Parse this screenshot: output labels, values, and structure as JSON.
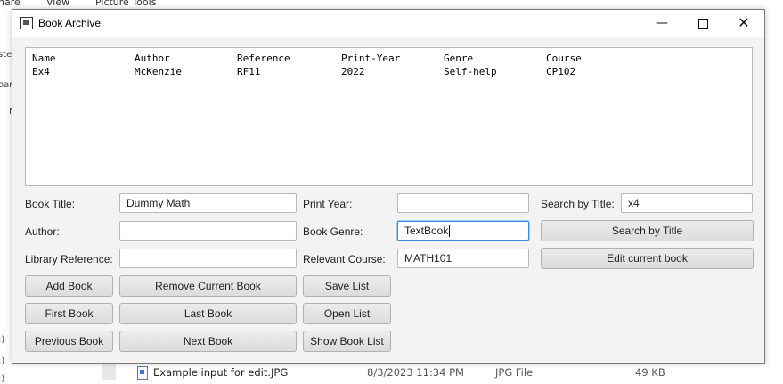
{
  "background": {
    "tabs": [
      "hare",
      "View",
      "Picture Tools"
    ],
    "left_fragments": [
      "ste",
      "oar",
      "N",
      ":)",
      ":)",
      ":)"
    ],
    "file_row": {
      "name": "Example input for edit.JPG",
      "date": "8/3/2023 11:34 PM",
      "type": "JPG File",
      "size": "49 KB"
    }
  },
  "window": {
    "title": "Book Archive",
    "controls": {
      "minimize": "—",
      "close": "✕"
    }
  },
  "list": {
    "headers": [
      "Name",
      "Author",
      "Reference",
      "Print-Year",
      "Genre",
      "Course"
    ],
    "rows": [
      [
        "Ex4",
        "McKenzie",
        "RF11",
        "2022",
        "Self-help",
        "CP102"
      ]
    ]
  },
  "form": {
    "book_title_label": "Book Title:",
    "book_title_value": "Dummy Math",
    "author_label": "Author:",
    "author_value": "",
    "library_ref_label": "Library Reference:",
    "library_ref_value": "",
    "print_year_label": "Print Year:",
    "print_year_value": "",
    "genre_label": "Book Genre:",
    "genre_value": "TextBook",
    "course_label": "Relevant Course:",
    "course_value": "MATH101",
    "search_label": "Search by Title:",
    "search_value": "x4"
  },
  "buttons": {
    "search_by_title": "Search by Title",
    "edit_current": "Edit current book",
    "add_book": "Add Book",
    "remove_current": "Remove Current Book",
    "save_list": "Save List",
    "first_book": "First Book",
    "last_book": "Last Book",
    "open_list": "Open List",
    "previous_book": "Previous Book",
    "next_book": "Next Book",
    "show_book_list": "Show Book List"
  }
}
